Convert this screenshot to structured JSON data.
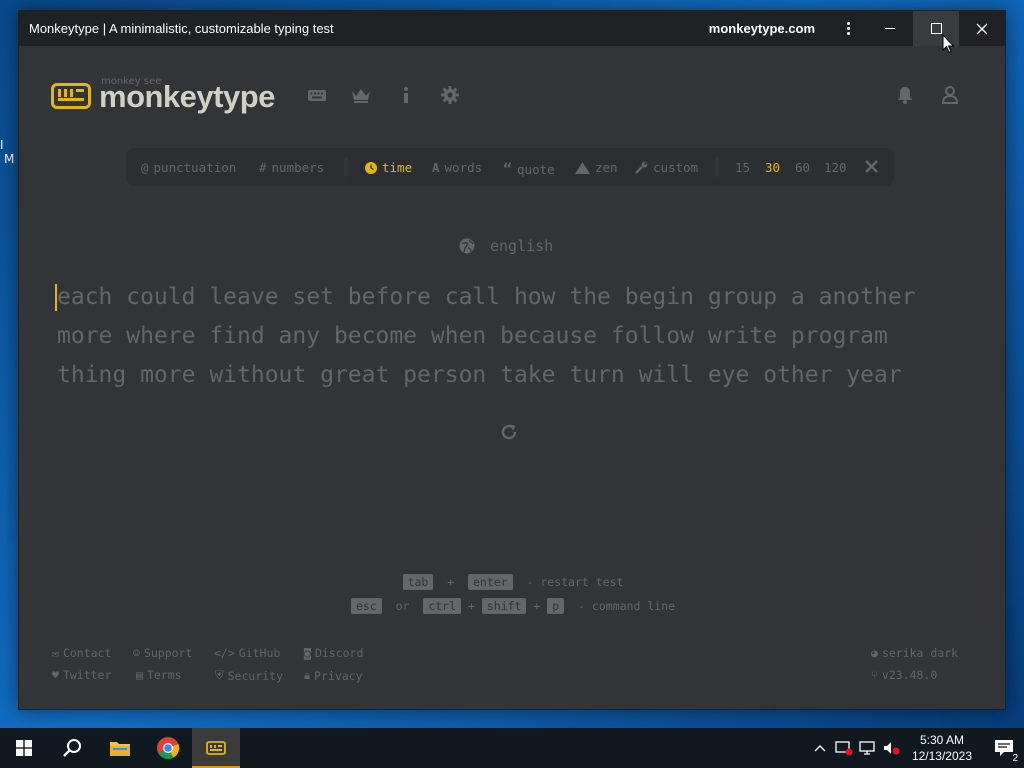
{
  "desktop": {
    "edge_text_1": "I",
    "edge_text_2": "M"
  },
  "window": {
    "title": "Monkeytype | A minimalistic, customizable typing test",
    "domain": "monkeytype.com"
  },
  "logo": {
    "top_text": "monkey see",
    "text": "monkeytype"
  },
  "config": {
    "punctuation": "punctuation",
    "numbers": "numbers",
    "time": "time",
    "words": "words",
    "quote": "quote",
    "zen": "zen",
    "custom": "custom",
    "durations": [
      "15",
      "30",
      "60",
      "120"
    ],
    "selected_duration": "30"
  },
  "test": {
    "language": "english",
    "lines": [
      "each could leave set before call how the begin group a another",
      "more where find any become when because follow write program",
      "thing more without great person take turn will eye other year"
    ]
  },
  "hints": {
    "key_tab": "tab",
    "plus": "+",
    "key_enter": "enter",
    "restart_text": "- restart test",
    "key_esc": "esc",
    "or": "or",
    "key_ctrl": "ctrl",
    "key_shift": "shift",
    "key_p": "p",
    "command_text": "- command line"
  },
  "footer": {
    "contact": "Contact",
    "support": "Support",
    "github": "GitHub",
    "discord": "Discord",
    "twitter": "Twitter",
    "terms": "Terms",
    "security": "Security",
    "privacy": "Privacy",
    "theme": "serika dark",
    "version": "v23.48.0"
  },
  "taskbar": {
    "time": "5:30 AM",
    "date": "12/13/2023",
    "notification_count": "2"
  },
  "colors": {
    "bg": "#323437",
    "main": "#e2b714",
    "sub": "#646669",
    "text": "#d1d0c5"
  }
}
